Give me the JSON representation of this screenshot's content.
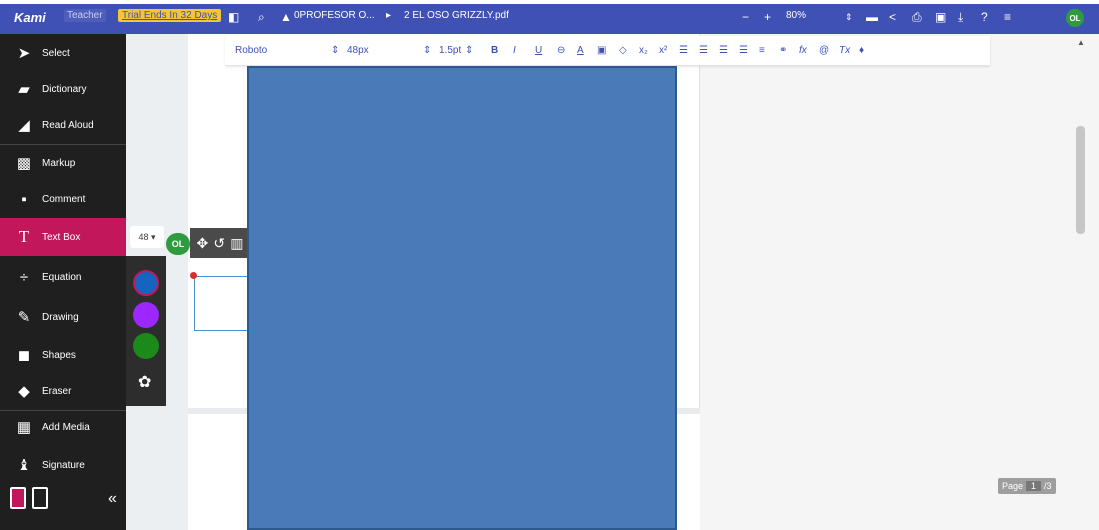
{
  "topbar": {
    "logo": "Kami",
    "teacher": "Teacher",
    "trial": "Trial Ends In 32 Days",
    "breadcrumb_folder": "0PROFESOR O...",
    "breadcrumb_sep": "▸",
    "file_name": "2 EL OSO GRIZZLY.pdf",
    "zoom_minus": "−",
    "zoom_plus": "+",
    "zoom": "80%",
    "avatar": "OL"
  },
  "sidebar": {
    "items": [
      {
        "label": "Select"
      },
      {
        "label": "Dictionary"
      },
      {
        "label": "Read Aloud"
      },
      {
        "label": "Markup"
      },
      {
        "label": "Comment"
      },
      {
        "label": "Text Box"
      },
      {
        "label": "Equation"
      },
      {
        "label": "Drawing"
      },
      {
        "label": "Shapes"
      },
      {
        "label": "Eraser"
      },
      {
        "label": "Add Media"
      },
      {
        "label": "Signature"
      }
    ]
  },
  "textbox_tool": {
    "size": "48 ▾",
    "avatar": "OL",
    "colors": [
      "#1565c0",
      "#9c27ff",
      "#1b8a1b"
    ]
  },
  "format_bar": {
    "font": "Roboto",
    "size": "48px",
    "line_spacing": "1.5pt"
  },
  "page_indicator": {
    "label": "Page",
    "current": "1",
    "total": "/3"
  },
  "colors": {
    "brand": "#3f51b5",
    "active_tool": "#c2185b",
    "sidebar": "#1f1f1f",
    "overlay": "#4a7ab8"
  }
}
